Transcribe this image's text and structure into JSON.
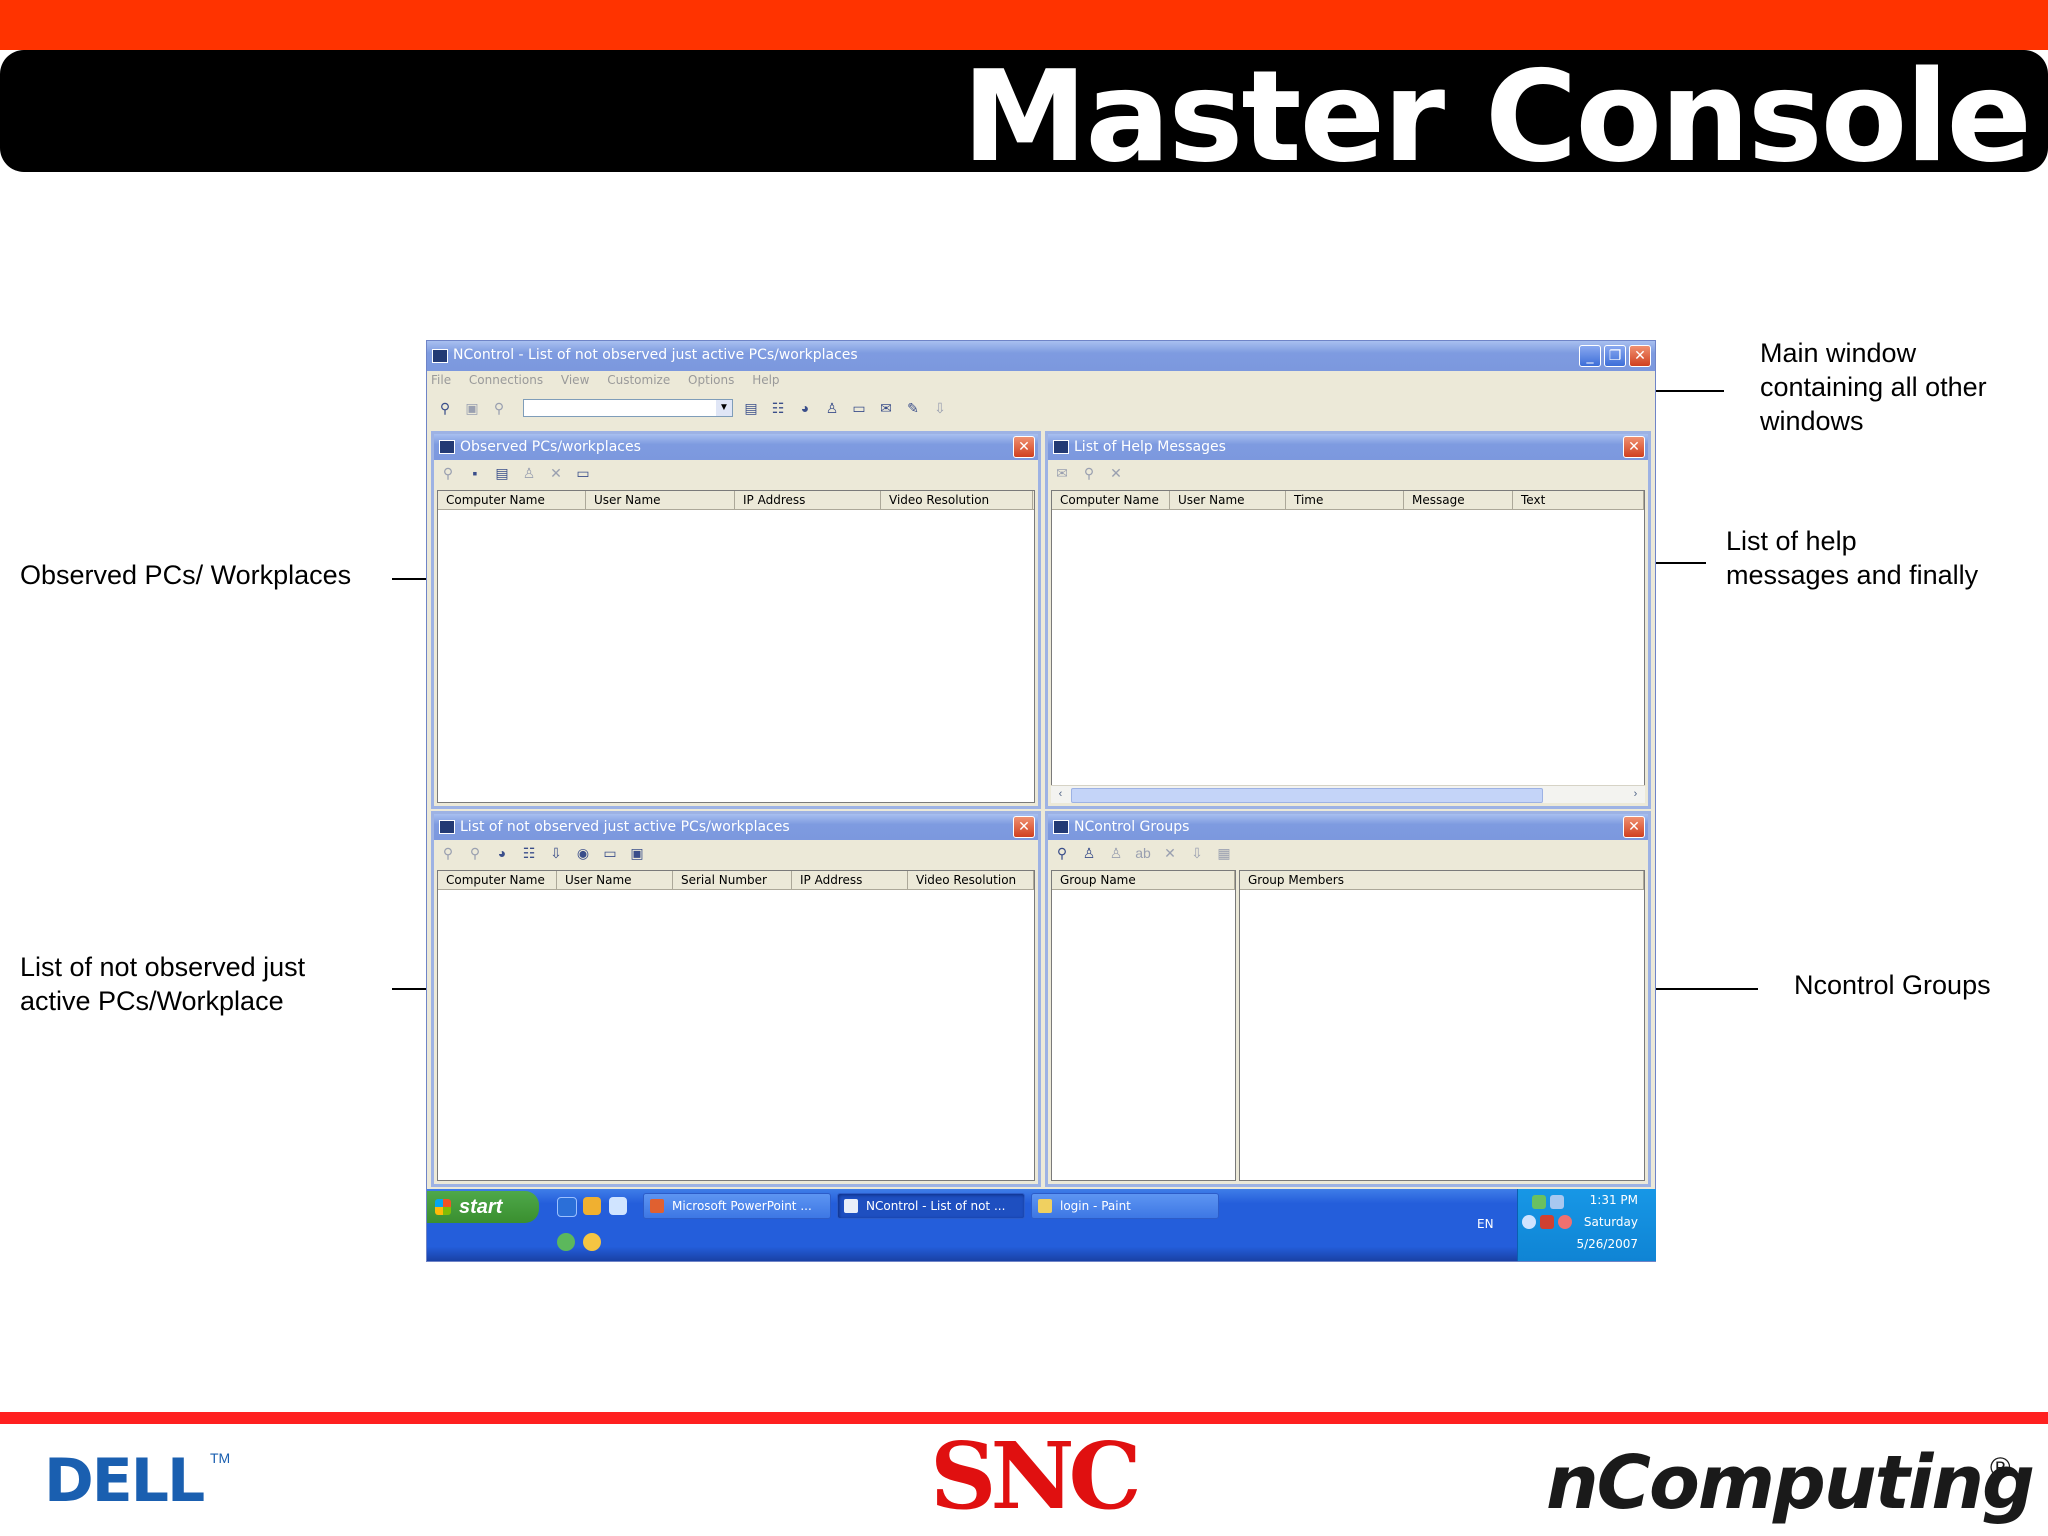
{
  "slide": {
    "title": "Master Console",
    "callouts": {
      "main_window": "Main window\ncontaining all other\nwindows",
      "help_messages": "List of help\nmessages and finally",
      "observed": "Observed PCs/ Workplaces",
      "not_observed": "List of not observed just\nactive PCs/Workplace",
      "groups": "Ncontrol Groups"
    },
    "brand_colors": {
      "top_bar": "#ff3300",
      "banner": "#000000",
      "footer_line": "#ff2020",
      "dell_blue": "#1a5fb0",
      "snc_red": "#e01010"
    }
  },
  "window": {
    "title": "NControl - List of not observed just active PCs/workplaces",
    "menu": [
      "File",
      "Connections",
      "View",
      "Customize",
      "Options",
      "Help"
    ],
    "toolbar_icons": [
      "binoculars-icon",
      "connect-icon",
      "find-icon",
      "properties-icon",
      "settings-icon",
      "globe-icon",
      "group-icon",
      "monitor-icon",
      "message-icon",
      "edit-icon",
      "download-icon"
    ]
  },
  "panes": {
    "observed": {
      "title": "Observed PCs/workplaces",
      "columns": [
        "Computer Name",
        "User Name",
        "IP Address",
        "Video Resolution"
      ]
    },
    "help": {
      "title": "List of Help Messages",
      "columns": [
        "Computer Name",
        "User Name",
        "Time",
        "Message",
        "Text"
      ]
    },
    "not_observed": {
      "title": "List of not observed just active PCs/workplaces",
      "columns": [
        "Computer Name",
        "User Name",
        "Serial Number",
        "IP Address",
        "Video Resolution"
      ]
    },
    "groups": {
      "title": "NControl Groups",
      "group_column": "Group Name",
      "members_column": "Group Members"
    }
  },
  "taskbar": {
    "start": "start",
    "tasks": [
      "Microsoft PowerPoint ...",
      "NControl - List of not ...",
      "login - Paint"
    ],
    "language": "EN",
    "time": "1:31 PM",
    "day": "Saturday",
    "date": "5/26/2007"
  },
  "logos": {
    "dell": "DELL",
    "dell_tm": "TM",
    "snc": "SNC",
    "ncomputing": "nComputing",
    "ncomputing_reg": "®"
  }
}
